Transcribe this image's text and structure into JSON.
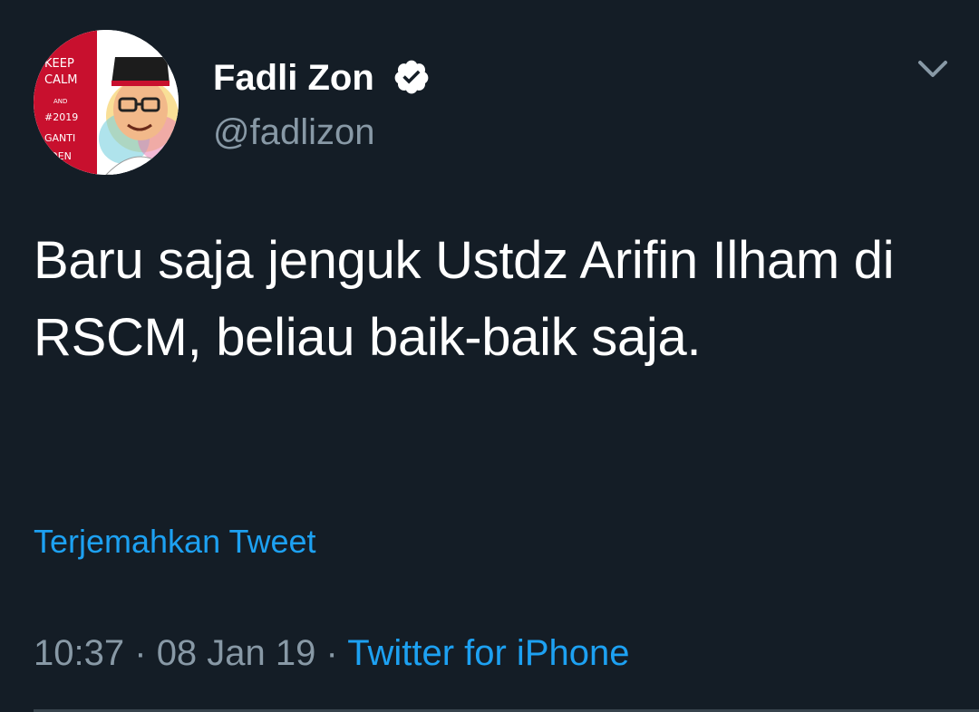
{
  "user": {
    "display_name": "Fadli Zon",
    "handle": "@fadlizon",
    "verified": true,
    "avatar_text": [
      "KEEP",
      "CALM",
      "AND",
      "#2019",
      "GANTI",
      "SIDEN"
    ]
  },
  "tweet": {
    "text": "Baru saja jenguk Ustdz Arifin Ilham di RSCM, beliau baik-baik saja.",
    "translate_label": "Terjemahkan Tweet"
  },
  "meta": {
    "time": "10:37",
    "separator": "·",
    "date": "08 Jan 19",
    "source": "Twitter for iPhone"
  },
  "icons": {
    "verified": "verified-badge-icon",
    "menu": "chevron-down-icon"
  },
  "colors": {
    "background": "#141d26",
    "text": "#ffffff",
    "secondary_text": "#8899a6",
    "link": "#1da1f2",
    "avatar_red": "#c8102e"
  }
}
